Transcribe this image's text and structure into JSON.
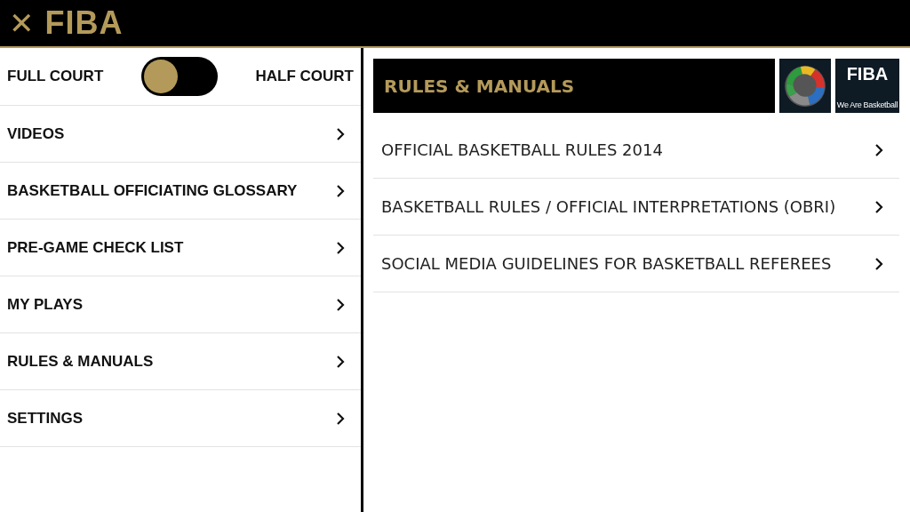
{
  "header": {
    "close_icon": "✕",
    "title": "FIBA"
  },
  "court_toggle": {
    "left_label": "FULL COURT",
    "right_label": "HALF COURT",
    "on": false
  },
  "menu": [
    {
      "label": "VIDEOS",
      "selected": false
    },
    {
      "label": "BASKETBALL OFFICIATING GLOSSARY",
      "selected": false
    },
    {
      "label": "PRE-GAME CHECK LIST",
      "selected": false
    },
    {
      "label": "MY PLAYS",
      "selected": false
    },
    {
      "label": "RULES & MANUALS",
      "selected": false
    },
    {
      "label": "SETTINGS",
      "selected": false
    }
  ],
  "content": {
    "title": "RULES & MANUALS",
    "logo": {
      "name": "FIBA",
      "tagline": "We Are Basketball"
    },
    "items": [
      {
        "label": "OFFICIAL BASKETBALL RULES 2014"
      },
      {
        "label": "BASKETBALL RULES / OFFICIAL INTERPRETATIONS (OBRI)"
      },
      {
        "label": "SOCIAL MEDIA GUIDELINES FOR BASKETBALL REFEREES"
      }
    ]
  }
}
